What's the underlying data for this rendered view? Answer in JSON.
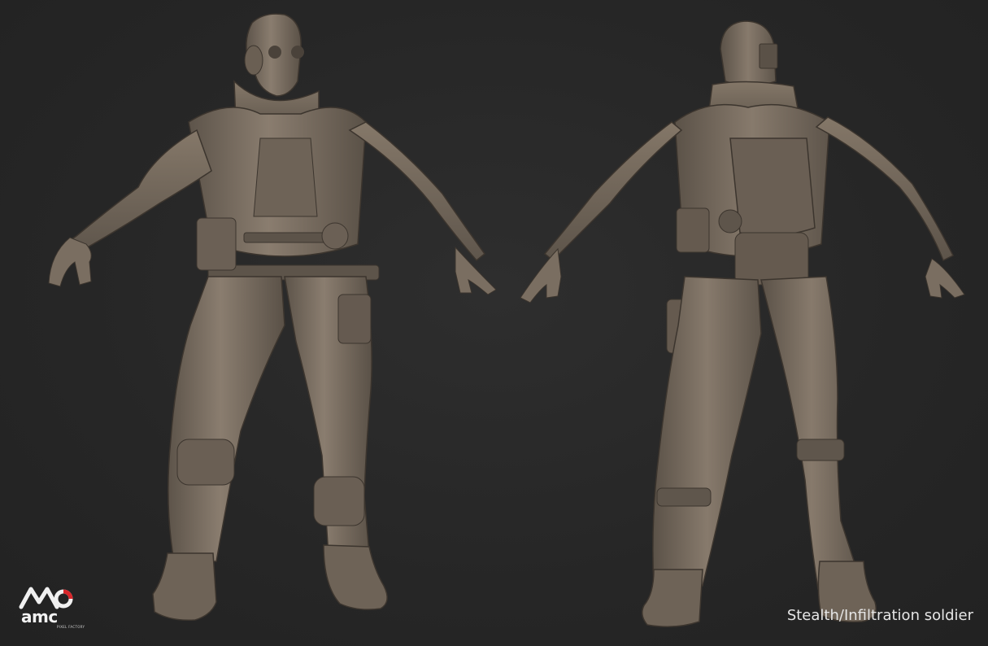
{
  "image": {
    "background_color": "#272727",
    "model_color": "#7a6e61",
    "subject": "soldier-sculpt"
  },
  "views": [
    {
      "name": "front-view"
    },
    {
      "name": "back-view"
    }
  ],
  "logo": {
    "text": "amc",
    "subtext": "PIXEL FACTORY",
    "accent_color": "#d8262a"
  },
  "caption": "Stealth/Infiltration soldier"
}
